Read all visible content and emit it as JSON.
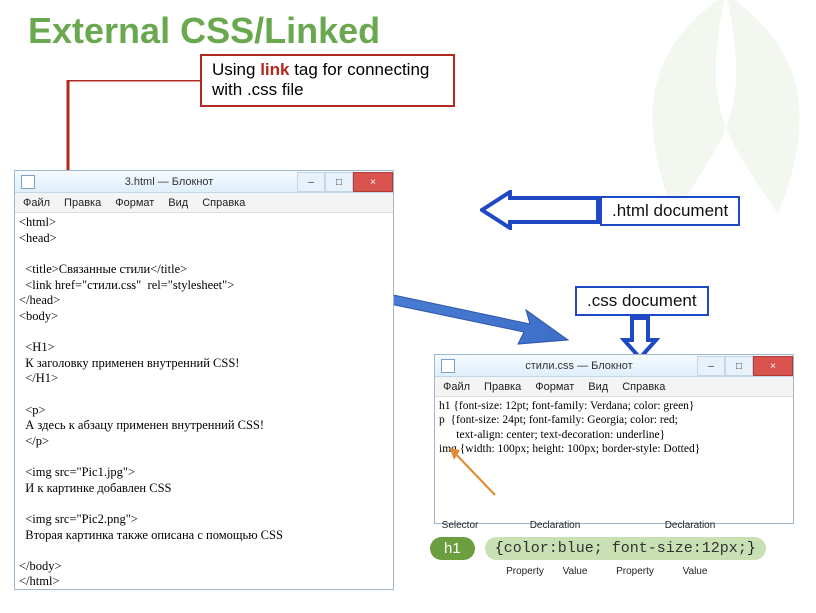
{
  "title": "External CSS/Linked",
  "callout": {
    "before": "Using ",
    "linkword": "link",
    "after": " tag for connecting\nwith .css file"
  },
  "labels": {
    "html_doc": ".html document",
    "css_doc": ".css document"
  },
  "notepad_html": {
    "window_title": "3.html — Блокнот",
    "menu": [
      "Файл",
      "Правка",
      "Формат",
      "Вид",
      "Справка"
    ],
    "content": "<html>\n<head>\n\n  <title>Связанные стили</title>\n  <link href=\"стили.css\"  rel=\"stylesheet\">\n</head>\n<body>\n\n  <H1>\n  К заголовку применен внутренний CSS!\n  </H1>\n\n  <p>\n  А здесь к абзацу применен внутренний CSS!\n  </p>\n\n  <img src=\"Pic1.jpg\">\n  И к картинке добавлен CSS\n\n  <img src=\"Pic2.png\">\n  Вторая картинка также описана с помощью CSS\n\n</body>\n</html>"
  },
  "notepad_css": {
    "window_title": "стили.css — Блокнот",
    "menu": [
      "Файл",
      "Правка",
      "Формат",
      "Вид",
      "Справка"
    ],
    "content": "h1 {font-size: 12pt; font-family: Verdana; color: green}\np  {font-size: 24pt; font-family: Georgia; color: red;\n      text-align: center; text-decoration: underline}\nimg {width: 100px; height: 100px; border-style: Dotted}"
  },
  "syntax": {
    "top": {
      "selector": "Selector",
      "decl1": "Declaration",
      "decl2": "Declaration"
    },
    "h1": "h1",
    "open": "{",
    "prop1": "color",
    "val1": "blue",
    "prop2": "font-size",
    "val2": "12px",
    "close": "}",
    "bottom": {
      "p1": "Property",
      "v1": "Value",
      "p2": "Property",
      "v2": "Value"
    }
  },
  "winbuttons": {
    "min": "–",
    "max": "□",
    "close": "×"
  }
}
